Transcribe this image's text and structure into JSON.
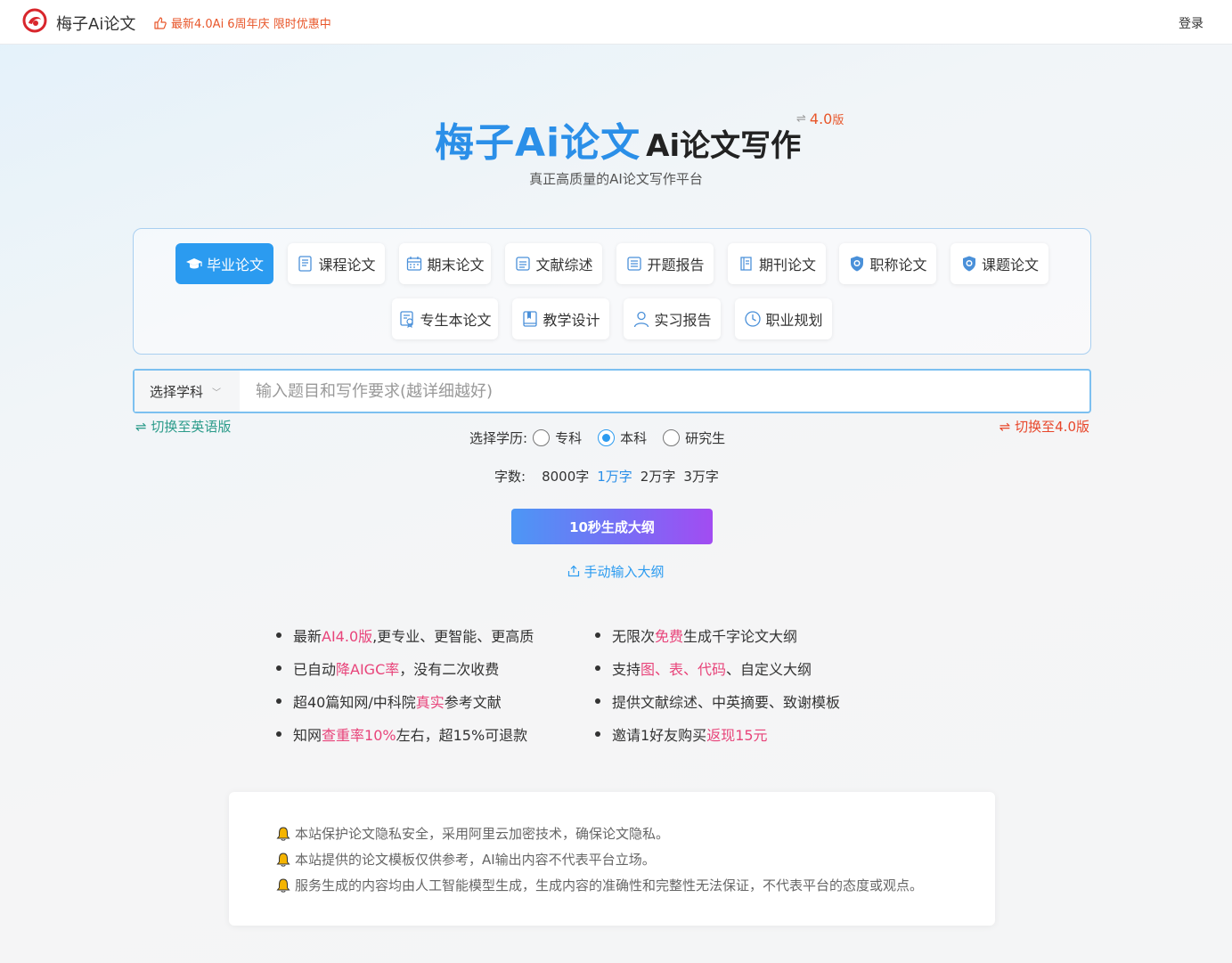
{
  "header": {
    "brand": "梅子Ai论文",
    "promo": "最新4.0Ai 6周年庆 限时优惠中",
    "login": "登录",
    "icons": {
      "logo": "meizi-logo-icon",
      "promo": "thumbs-up-icon"
    }
  },
  "hero": {
    "brand": "梅子Ai论文",
    "subtitle": "Ai论文写作",
    "version_symbol": "⇌",
    "version_num": "4.0",
    "version_suffix": "版",
    "tagline": "真正高质量的AI论文写作平台"
  },
  "categories": [
    {
      "label": "毕业论文",
      "icon": "graduation-cap-icon",
      "active": true
    },
    {
      "label": "课程论文",
      "icon": "document-icon",
      "active": false
    },
    {
      "label": "期末论文",
      "icon": "calendar-icon",
      "active": false
    },
    {
      "label": "文献综述",
      "icon": "doc-list-icon",
      "active": false
    },
    {
      "label": "开题报告",
      "icon": "report-icon",
      "active": false
    },
    {
      "label": "期刊论文",
      "icon": "journal-icon",
      "active": false
    },
    {
      "label": "职称论文",
      "icon": "shield-badge-icon",
      "active": false
    },
    {
      "label": "课题论文",
      "icon": "shield-badge-icon",
      "active": false
    },
    {
      "label": "专生本论文",
      "icon": "certificate-icon",
      "active": false
    },
    {
      "label": "教学设计",
      "icon": "book-icon",
      "active": false
    },
    {
      "label": "实习报告",
      "icon": "person-icon",
      "active": false
    },
    {
      "label": "职业规划",
      "icon": "clock-icon",
      "active": false
    }
  ],
  "search": {
    "subject_label": "选择学科",
    "placeholder": "输入题目和写作要求(越详细越好)",
    "value": ""
  },
  "switch": {
    "english": "⇌ 切换至英语版",
    "v4": "⇌ 切换至4.0版"
  },
  "education": {
    "label": "选择学历:",
    "options": [
      {
        "label": "专科",
        "checked": false
      },
      {
        "label": "本科",
        "checked": true
      },
      {
        "label": "研究生",
        "checked": false
      }
    ]
  },
  "wordcount": {
    "label": "字数:",
    "options": [
      {
        "label": "8000字",
        "active": false
      },
      {
        "label": "1万字",
        "active": true
      },
      {
        "label": "2万字",
        "active": false
      },
      {
        "label": "3万字",
        "active": false
      }
    ]
  },
  "generate_label": "10秒生成大纲",
  "manual_label": "手动输入大纲",
  "features": {
    "left": [
      [
        {
          "t": "最新"
        },
        {
          "t": "AI4.0版",
          "hl": true
        },
        {
          "t": ",更专业、更智能、更高质"
        }
      ],
      [
        {
          "t": "已自动"
        },
        {
          "t": "降AIGC率",
          "hl": true
        },
        {
          "t": "，没有二次收费"
        }
      ],
      [
        {
          "t": "超40篇知网/中科院"
        },
        {
          "t": "真实",
          "hl": true
        },
        {
          "t": "参考文献"
        }
      ],
      [
        {
          "t": "知网"
        },
        {
          "t": "查重率10%",
          "hl": true
        },
        {
          "t": "左右，超15%可退款"
        }
      ]
    ],
    "right": [
      [
        {
          "t": "无限次"
        },
        {
          "t": "免费",
          "hl": true
        },
        {
          "t": "生成千字论文大纲"
        }
      ],
      [
        {
          "t": "支持"
        },
        {
          "t": "图、表、代码",
          "hl": true
        },
        {
          "t": "、自定义大纲"
        }
      ],
      [
        {
          "t": "提供文献综述、中英摘要、致谢模板"
        }
      ],
      [
        {
          "t": "邀请1好友购买"
        },
        {
          "t": "返现15元",
          "hl": true
        }
      ]
    ]
  },
  "notices": [
    "本站保护论文隐私安全，采用阿里云加密技术，确保论文隐私。",
    "本站提供的论文模板仅供参考，AI输出内容不代表平台立场。",
    "服务生成的内容均由人工智能模型生成，生成内容的准确性和完整性无法保证，不代表平台的态度或观点。"
  ],
  "colors": {
    "accent": "#2b9bf0",
    "brand_blue": "#2b8fe8",
    "highlight": "#e8447a",
    "promo": "#e8562a"
  }
}
